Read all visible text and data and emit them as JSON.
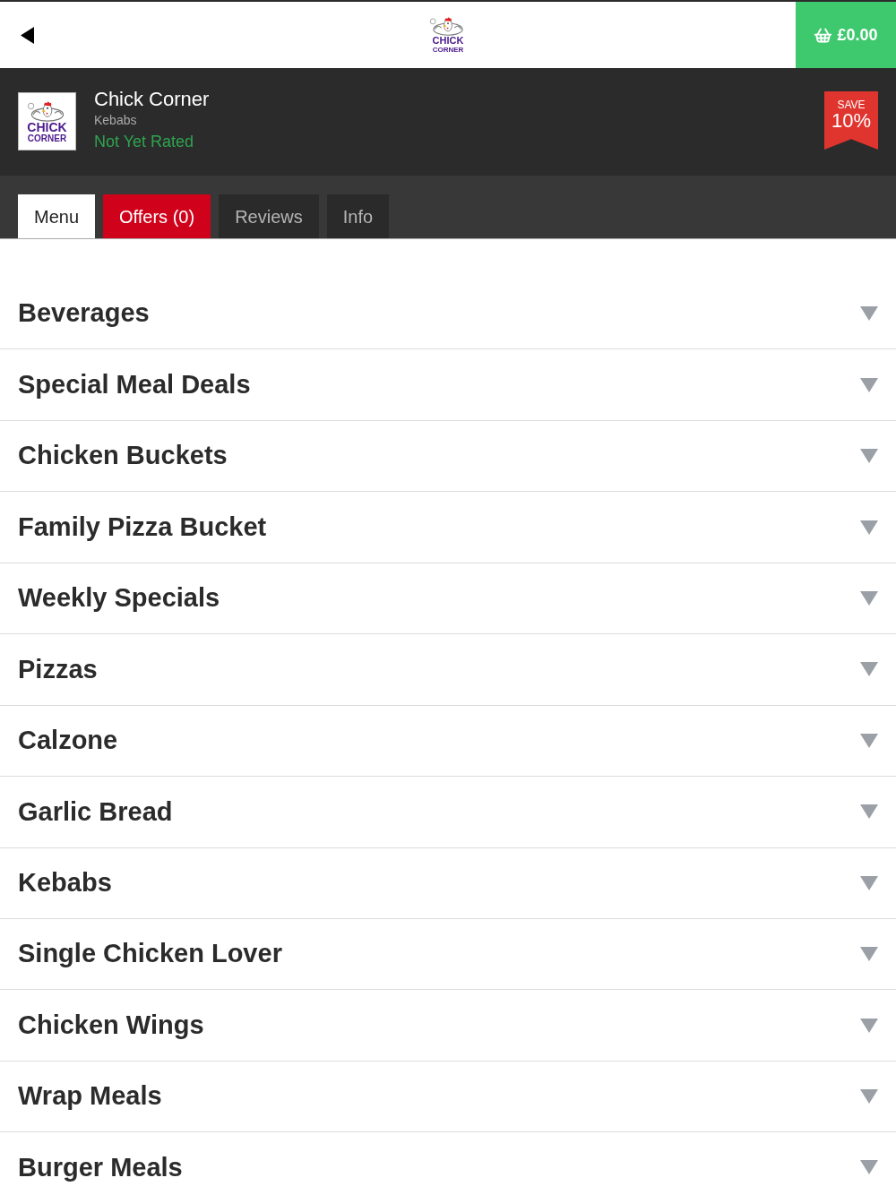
{
  "header": {
    "logo": {
      "line1": "CHICK",
      "line2": "CORNER"
    },
    "cart": {
      "total": "£0.00"
    }
  },
  "restaurant": {
    "logo": {
      "line1": "CHICK",
      "line2": "CORNER"
    },
    "name": "Chick Corner",
    "cuisine": "Kebabs",
    "rating": "Not Yet Rated",
    "badge": {
      "line1": "SAVE",
      "line2": "10%"
    }
  },
  "tabs": [
    {
      "label": "Menu",
      "selected": true,
      "kind": "plain"
    },
    {
      "label": "Offers (0)",
      "selected": false,
      "kind": "offer"
    },
    {
      "label": "Reviews",
      "selected": false,
      "kind": "plain"
    },
    {
      "label": "Info",
      "selected": false,
      "kind": "plain"
    }
  ],
  "categories": [
    {
      "name": "Beverages",
      "expanded": false
    },
    {
      "name": "Special Meal Deals",
      "expanded": false
    },
    {
      "name": "Chicken Buckets",
      "expanded": false
    },
    {
      "name": "Family Pizza Bucket",
      "expanded": false
    },
    {
      "name": "Weekly Specials",
      "expanded": false
    },
    {
      "name": "Pizzas",
      "expanded": false
    },
    {
      "name": "Calzone",
      "expanded": false
    },
    {
      "name": "Garlic Bread",
      "expanded": false
    },
    {
      "name": "Kebabs",
      "expanded": false
    },
    {
      "name": "Single Chicken Lover",
      "expanded": false
    },
    {
      "name": "Chicken Wings",
      "expanded": false
    },
    {
      "name": "Wrap Meals",
      "expanded": false
    },
    {
      "name": "Burger Meals",
      "expanded": false
    }
  ]
}
